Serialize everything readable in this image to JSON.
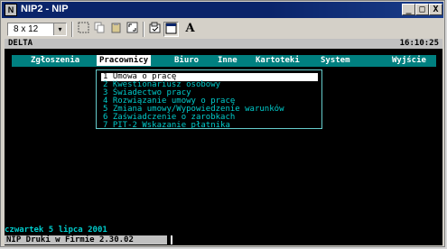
{
  "window": {
    "title": "NIP2 - NIP",
    "app_icon_text": "N",
    "controls": {
      "minimize": "_",
      "maximize": "□",
      "close": "X"
    }
  },
  "toolbar": {
    "font_size": "8 x 12",
    "font_dropdown_arrow": "▾",
    "font_tool_label": "A",
    "icons": [
      "select-icon",
      "copy-icon",
      "paste-icon",
      "fullscreen-icon",
      "properties-icon",
      "background-icon",
      "font-icon"
    ]
  },
  "console": {
    "top_left": "DELTA",
    "top_right": "16:10:25",
    "menu": [
      {
        "label": "Zgłoszenia",
        "active": false
      },
      {
        "label": "Pracownicy",
        "active": true
      },
      {
        "label": "Biuro",
        "active": false
      },
      {
        "label": "Inne",
        "active": false
      },
      {
        "label": "Kartoteki",
        "active": false
      },
      {
        "label": "System",
        "active": false
      },
      {
        "label": "Wyjście",
        "active": false
      }
    ],
    "dropdown": [
      {
        "label": "1 Umowa o pracę",
        "selected": true
      },
      {
        "label": "2 Kwestionariusz osobowy",
        "selected": false
      },
      {
        "label": "3 Świadectwo pracy",
        "selected": false
      },
      {
        "label": "4 Rozwiązanie umowy o pracę",
        "selected": false
      },
      {
        "label": "5 Zmiana umowy/Wypowiedzenie warunków",
        "selected": false
      },
      {
        "label": "6 Zaświadczenie o zarobkach",
        "selected": false
      },
      {
        "label": "7 PIT-2 Wskazanie płatnika",
        "selected": false
      }
    ],
    "date_line": "czwartek  5 lipca 2001",
    "status_line": " NIP Druki w Firmie 2.30.02 "
  },
  "colors": {
    "titlebar": "#0a246a",
    "console_bg": "#000000",
    "menubar_bg": "#008080",
    "menu_text": "#ffffff",
    "dropdown_text": "#00cccc",
    "selection_bg": "#ffffff"
  }
}
